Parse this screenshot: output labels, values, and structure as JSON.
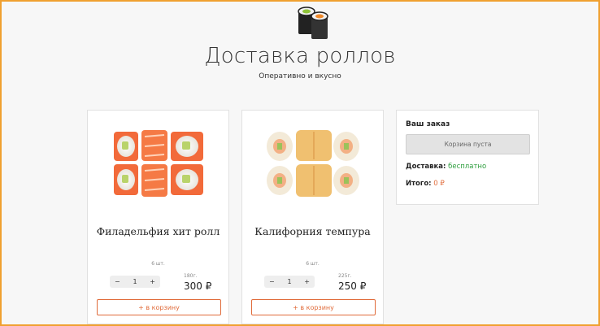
{
  "header": {
    "title": "Доставка роллов",
    "subtitle": "Оперативно и вкусно",
    "logo_icon": "sushi-rolls-icon"
  },
  "products": [
    {
      "name": "Филадельфия хит ролл",
      "pieces": "6 шт.",
      "weight": "180г.",
      "price": "300 ₽",
      "quantity": "1",
      "minus": "−",
      "plus": "+",
      "add_label": "+ в корзину"
    },
    {
      "name": "Калифорния темпура",
      "pieces": "6 шт.",
      "weight": "225г.",
      "price": "250 ₽",
      "quantity": "1",
      "minus": "−",
      "plus": "+",
      "add_label": "+ в корзину"
    }
  ],
  "order": {
    "title": "Ваш заказ",
    "empty_text": "Корзина пуста",
    "delivery_label": "Доставка:",
    "delivery_value": "бесплатно",
    "total_label": "Итого:",
    "total_value": "0 ₽"
  },
  "colors": {
    "accent": "#e06b3a",
    "success": "#2e9e3e",
    "frame": "#f0a030"
  }
}
